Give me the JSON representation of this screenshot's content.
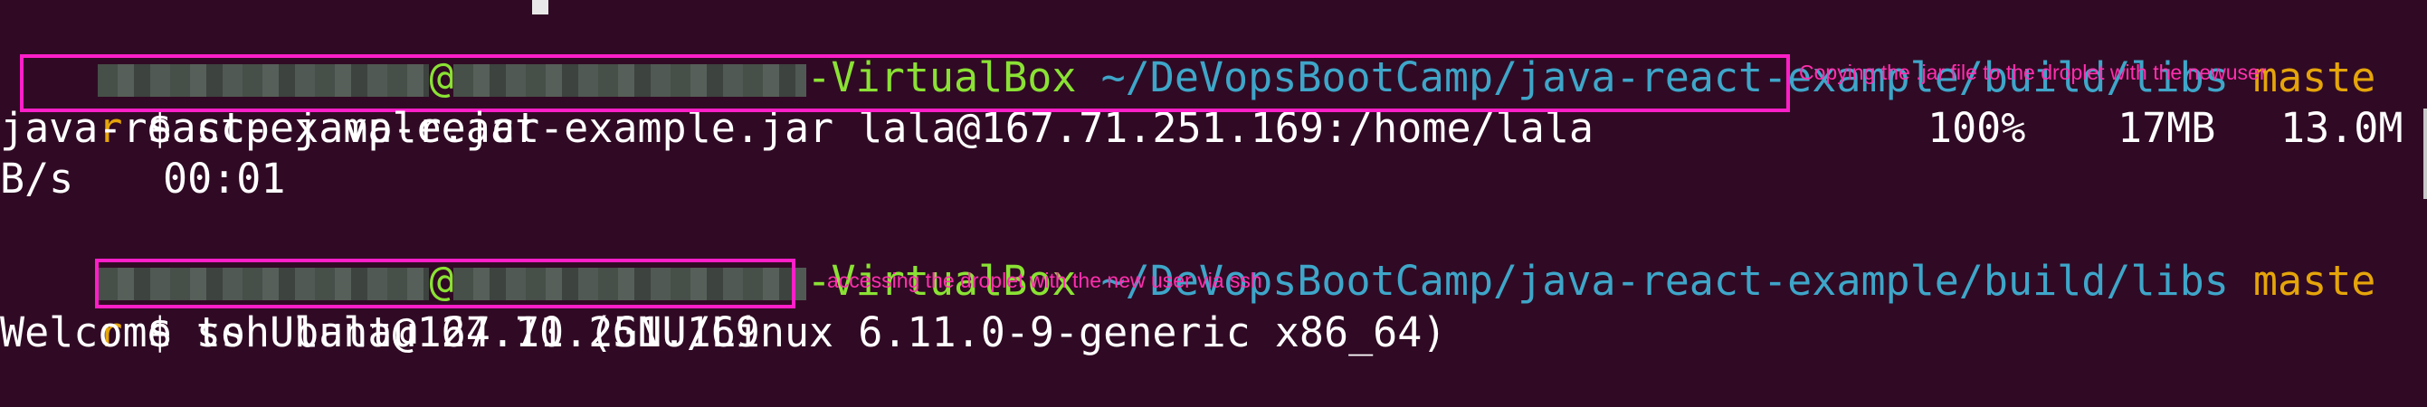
{
  "prompts": [
    {
      "user_host_suffix": "-VirtualBox",
      "at": "@",
      "path": "~/DeVopsBootCamp/java-react-example/build/libs",
      "branch_cut": "maste",
      "branch_tail": "r",
      "symbol": "$",
      "command": "scp java-react-example.jar lala@167.71.251.169:/home/lala"
    },
    {
      "user_host_suffix": "-VirtualBox",
      "at": "@",
      "path": "~/DeVopsBootCamp/java-react-example/build/libs",
      "branch_cut": "maste",
      "branch_tail": "r",
      "symbol": "$",
      "command": "ssh lala@167.71.251.169"
    }
  ],
  "scp_output": {
    "filename": "java-react-example.jar",
    "progress": "100%",
    "size": "17MB",
    "rate_part1": "13.0M",
    "rate_part2": "B/s",
    "time": "00:01"
  },
  "welcome_line": "Welcome to Ubuntu 24.10 (GNU/Linux 6.11.0-9-generic x86_64)",
  "annotations": {
    "scp_note": "Copying the .jar file to the droplet with the newuser",
    "ssh_note": "accessing the droplet with the new user via ssh"
  },
  "colors": {
    "background": "#300a24",
    "user_host": "#8ae234",
    "path": "#3ea6c9",
    "branch": "#e5a50a",
    "annotation": "#ff1fc8"
  }
}
